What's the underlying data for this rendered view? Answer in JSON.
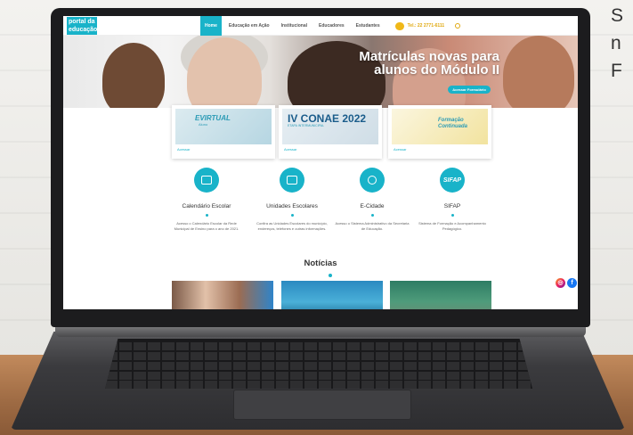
{
  "side_text": {
    "line1": "S",
    "line2": "n",
    "line3": "F"
  },
  "site": {
    "logo_text": "portal da educação",
    "nav": {
      "items": [
        "Home",
        "Educação em Ação",
        "Institucional",
        "Educadores",
        "Estudantes"
      ],
      "phone": "Tel.: 22 2771-6111"
    },
    "banner": {
      "title_line1": "Matrículas novas para",
      "title_line2": "alunos do Módulo II",
      "button": "Acessar Formulário"
    },
    "cards": [
      {
        "title": "EVIRTUAL",
        "subtitle": "Aluno",
        "caption": "Acessar"
      },
      {
        "title": "IV CONAE 2022",
        "subtitle": "ETAPA INTERMUNICIPAL",
        "caption": "Acessar"
      },
      {
        "title": "Formação Continuada",
        "caption": "Acessar"
      }
    ],
    "services": [
      {
        "title": "Calendário Escolar",
        "desc": "Acesso o Calendário Escolar da Rede Municipal de Ensino para o ano de 2021."
      },
      {
        "title": "Unidades Escolares",
        "desc": "Confira as Unidades Escolares do município, endereços, telefones e outras informações."
      },
      {
        "title": "E-Cidade",
        "desc": "Acesso o Sistema Administrativo da Secretaria de Educação."
      },
      {
        "title": "SIFAP",
        "icon_label": "SIFAP",
        "desc": "Sistema de Formação e Acompanhamento Pedagógico."
      }
    ],
    "news_title": "Notícias"
  },
  "colors": {
    "accent": "#19b3c9",
    "phone": "#e0a80e"
  }
}
